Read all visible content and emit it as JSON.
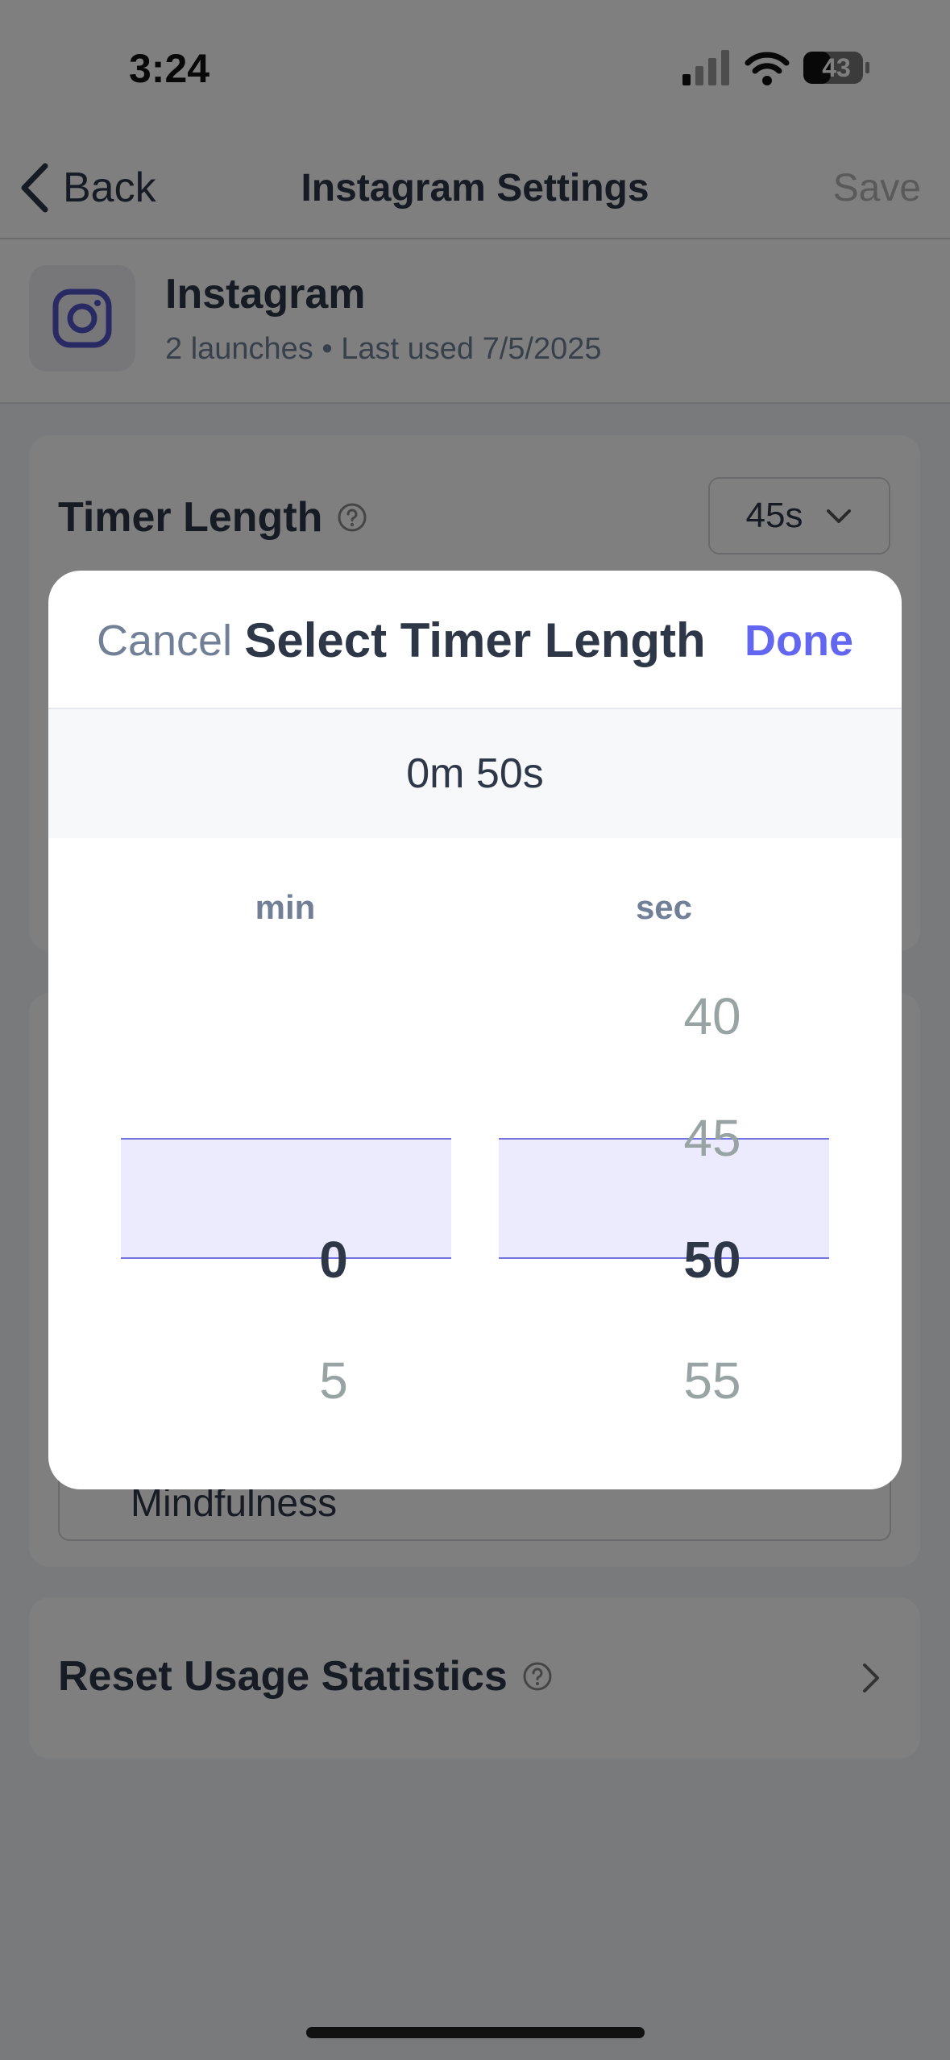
{
  "status_bar": {
    "time": "3:24",
    "battery": "43"
  },
  "nav": {
    "back_label": "Back",
    "title": "Instagram Settings",
    "save_label": "Save"
  },
  "app": {
    "name": "Instagram",
    "meta": "2 launches • Last used 7/5/2025"
  },
  "timer": {
    "label": "Timer Length",
    "selected_value": "45s"
  },
  "category": {
    "visible_option": "Mindfulness"
  },
  "reset": {
    "label": "Reset Usage Statistics"
  },
  "modal": {
    "cancel_label": "Cancel",
    "title": "Select Timer Length",
    "done_label": "Done",
    "duration_display": "0m 50s",
    "minutes": {
      "header": "min",
      "items": [
        "0",
        "5"
      ],
      "selected": "0"
    },
    "seconds": {
      "header": "sec",
      "items": [
        "40",
        "45",
        "50",
        "55"
      ],
      "selected": "50"
    }
  },
  "colors": {
    "accent": "#6366f1",
    "text_primary": "#2d3748",
    "text_secondary": "#718096"
  },
  "icons": [
    "back-chevron-icon",
    "instagram-icon",
    "help-icon",
    "chevron-down-icon",
    "chevron-right-icon",
    "signal-icon",
    "wifi-icon",
    "battery-icon"
  ]
}
